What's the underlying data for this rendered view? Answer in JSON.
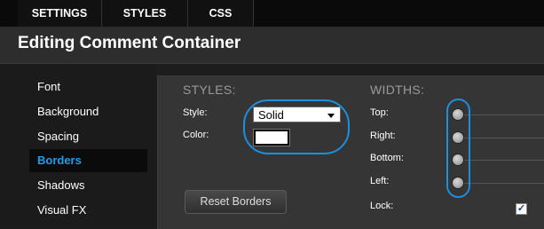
{
  "tabs": [
    "SETTINGS",
    "STYLES",
    "CSS"
  ],
  "header": {
    "title": "Editing Comment Container"
  },
  "sidebar": {
    "items": [
      {
        "label": "Font"
      },
      {
        "label": "Background"
      },
      {
        "label": "Spacing"
      },
      {
        "label": "Borders",
        "active": true
      },
      {
        "label": "Shadows"
      },
      {
        "label": "Visual FX"
      }
    ]
  },
  "styles": {
    "title": "STYLES:",
    "style_label": "Style:",
    "style_value": "Solid",
    "color_label": "Color:",
    "color_value": "#ffffff",
    "reset_label": "Reset Borders"
  },
  "widths": {
    "title": "WIDTHS:",
    "labels": [
      "Top:",
      "Right:",
      "Bottom:",
      "Left:"
    ],
    "lock_label": "Lock:",
    "lock_checked": true
  },
  "colors": {
    "accent": "#1e9ee8",
    "highlight_ring": "#1c8fde"
  }
}
